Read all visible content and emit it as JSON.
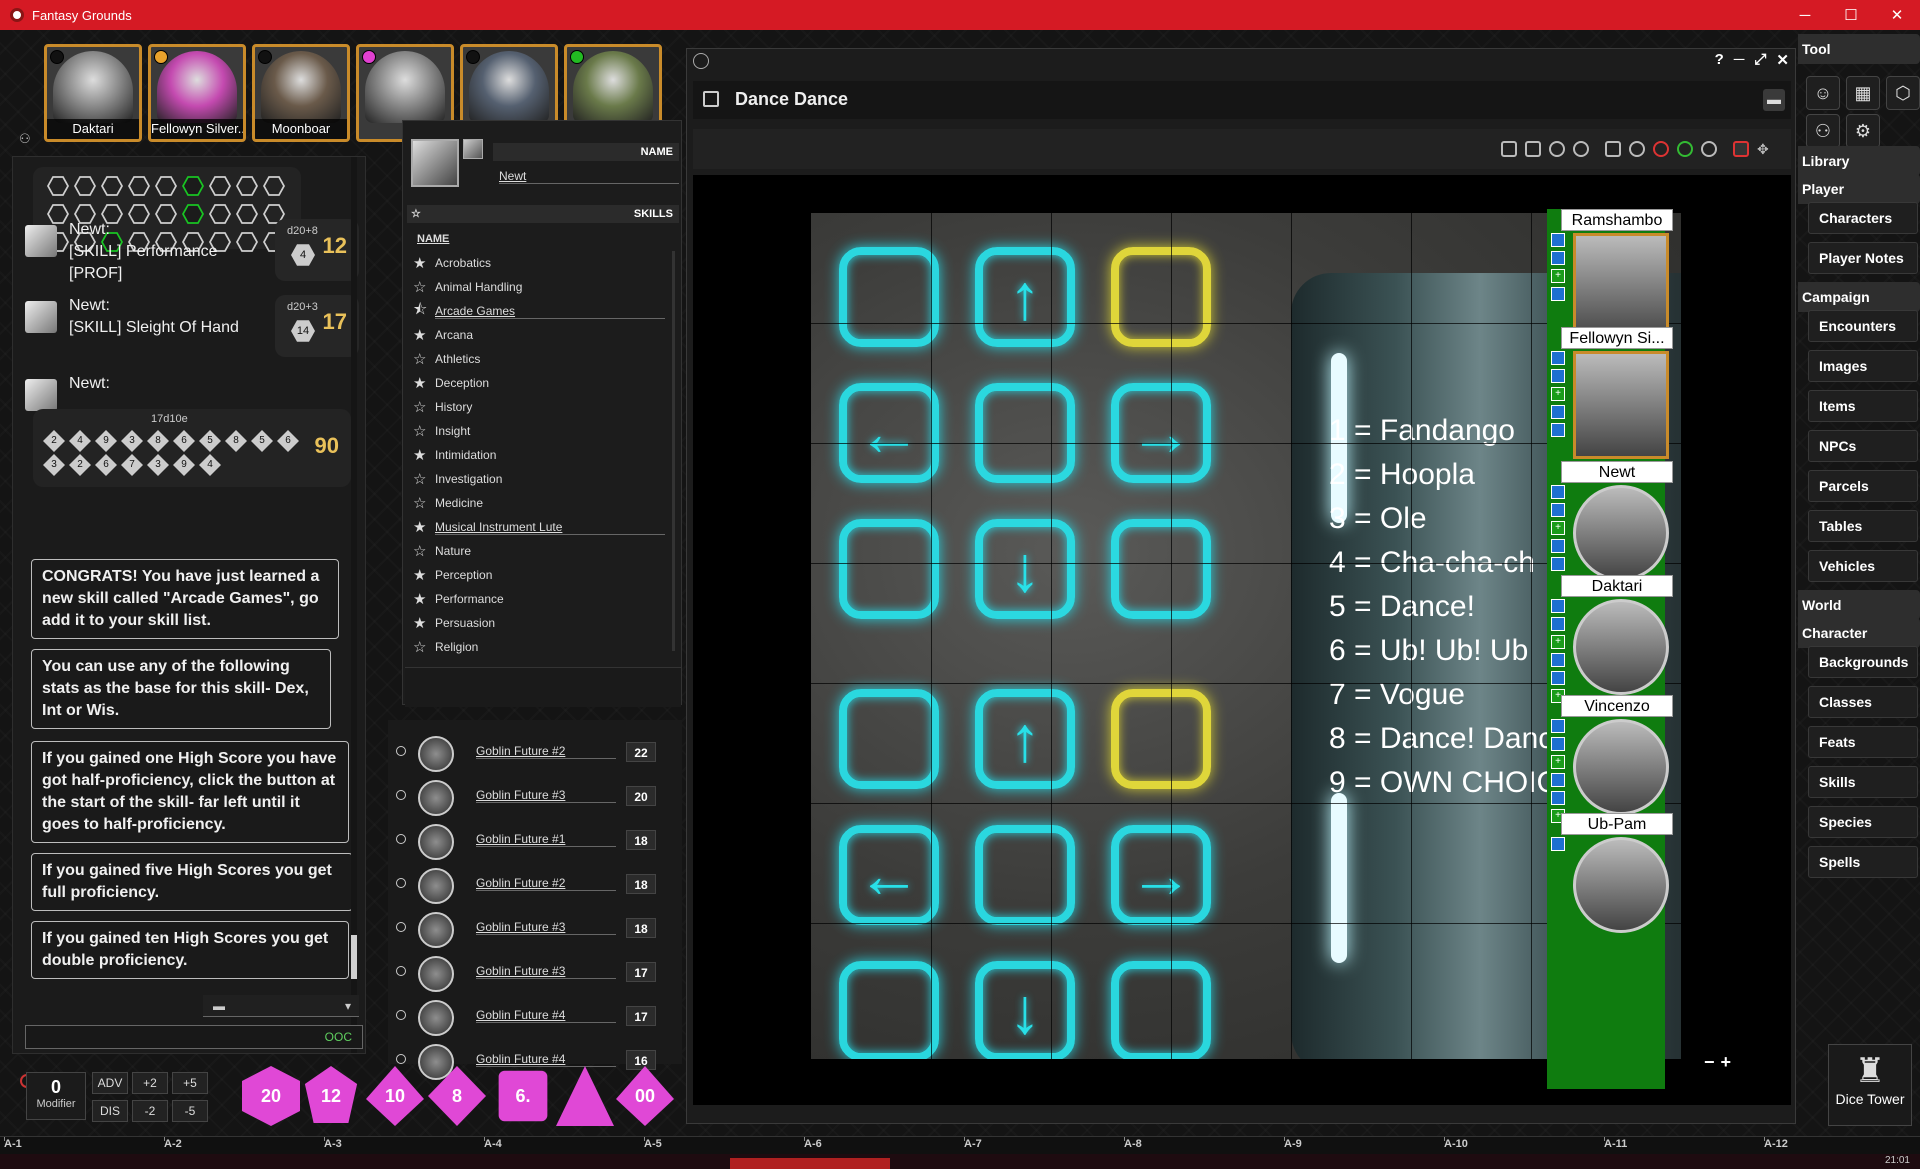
{
  "window": {
    "title": "Fantasy Grounds",
    "controls": [
      "─",
      "☐",
      "✕"
    ]
  },
  "portraits": [
    {
      "name": "Daktari",
      "dot": "#111111",
      "color": "#8a8a8a"
    },
    {
      "name": "Fellowyn Silver...",
      "dot": "#e8a22c",
      "color": "#c44ab0"
    },
    {
      "name": "Moonboar",
      "dot": "#111111",
      "color": "#6a5a4a"
    },
    {
      "name": "",
      "dot": "#e040d0",
      "color": "#888888"
    },
    {
      "name": "",
      "dot": "#111111",
      "color": "#556070"
    },
    {
      "name": "",
      "dot": "#22bb22",
      "color": "#6a7a4a"
    }
  ],
  "chat": {
    "messages": [
      {
        "author": "Newt:",
        "lines": [
          "[SKILL] Performance",
          "[PROF]"
        ],
        "dice": "d20+8",
        "die_face": "4",
        "total": "12"
      },
      {
        "author": "Newt:",
        "lines": [
          "[SKILL] Sleight Of Hand"
        ],
        "dice": "d20+3",
        "die_face": "14",
        "total": "17"
      },
      {
        "author": "Newt:",
        "lines": [],
        "dice": "17d10e",
        "total": "90"
      }
    ],
    "big_roll_faces": [
      "2",
      "4",
      "9",
      "3",
      "8",
      "6",
      "5",
      "8",
      "5",
      "6",
      "3",
      "2",
      "6",
      "7",
      "3",
      "9",
      "4"
    ],
    "info": [
      "CONGRATS! You have just learned a new skill called \"Arcade Games\", go add it to your skill list.",
      "You can use any of the following stats as the base for this skill- Dex, Int or Wis.",
      "If you gained one High Score you have got half-proficiency, click the button at the start of the skill- far left until it goes to half-proficiency.",
      "If you gained five High Scores you get full proficiency.",
      "If you gained ten High Scores you get double proficiency."
    ],
    "ooc_label": "OOC"
  },
  "skills_panel": {
    "name_header": "NAME",
    "name_value": "Newt",
    "skills_header": "SKILLS",
    "column_name": "NAME",
    "skills": [
      {
        "label": "Acrobatics",
        "prof": "full",
        "link": false
      },
      {
        "label": "Animal Handling",
        "prof": "none",
        "link": false
      },
      {
        "label": "Arcade Games",
        "prof": "half",
        "link": true
      },
      {
        "label": "Arcana",
        "prof": "full",
        "link": false
      },
      {
        "label": "Athletics",
        "prof": "none",
        "link": false
      },
      {
        "label": "Deception",
        "prof": "full",
        "link": false
      },
      {
        "label": "History",
        "prof": "none",
        "link": false
      },
      {
        "label": "Insight",
        "prof": "none",
        "link": false
      },
      {
        "label": "Intimidation",
        "prof": "full",
        "link": false
      },
      {
        "label": "Investigation",
        "prof": "none",
        "link": false
      },
      {
        "label": "Medicine",
        "prof": "none",
        "link": false
      },
      {
        "label": "Musical Instrument Lute",
        "prof": "full",
        "link": true
      },
      {
        "label": "Nature",
        "prof": "none",
        "link": false
      },
      {
        "label": "Perception",
        "prof": "full",
        "link": false
      },
      {
        "label": "Performance",
        "prof": "full",
        "link": false
      },
      {
        "label": "Persuasion",
        "prof": "full",
        "link": false
      },
      {
        "label": "Religion",
        "prof": "none",
        "link": false
      }
    ]
  },
  "combat_tracker": [
    {
      "name": "Goblin Future #2",
      "init": "22"
    },
    {
      "name": "Goblin Future #3",
      "init": "20"
    },
    {
      "name": "Goblin Future #1",
      "init": "18"
    },
    {
      "name": "Goblin Future #2",
      "init": "18"
    },
    {
      "name": "Goblin Future #3",
      "init": "18"
    },
    {
      "name": "Goblin Future #3",
      "init": "17"
    },
    {
      "name": "Goblin Future #4",
      "init": "17"
    },
    {
      "name": "Goblin Future #4",
      "init": "16"
    }
  ],
  "modifier": {
    "value": "0",
    "label": "Modifier",
    "buttons": [
      "ADV",
      "+2",
      "+5",
      "DIS",
      "-2",
      "-5"
    ]
  },
  "dice_tray": [
    "20",
    "12",
    "10",
    "8",
    "6.",
    "",
    "00"
  ],
  "image_window": {
    "title": "Dance Dance",
    "controls": [
      "?",
      "─",
      "⤢",
      "✕"
    ],
    "dance_moves": [
      "1 = Fandango",
      "2 = Hoopla",
      "3 = Ole",
      "4 = Cha-cha-ch",
      "5 = Dance!",
      "6 = Ub! Ub! Ub",
      "7 = Vogue",
      "8 = Dance! Dance!",
      "9 = OWN CHOIC"
    ],
    "zoom_minus": "−",
    "zoom_plus": "+"
  },
  "party_tokens": [
    {
      "name": "Ramshambo",
      "round": false,
      "effects": 4
    },
    {
      "name": "Fellowyn Si...",
      "round": false,
      "effects": 5
    },
    {
      "name": "Newt",
      "round": true,
      "effects": 5
    },
    {
      "name": "Daktari",
      "round": true,
      "effects": 6
    },
    {
      "name": "Vincenzo",
      "round": true,
      "effects": 6
    },
    {
      "name": "Ub-Pam",
      "round": true,
      "effects": 1
    }
  ],
  "sidebar": {
    "sections": [
      {
        "title": "Tool",
        "items": []
      },
      {
        "title": "Library",
        "items": []
      },
      {
        "title": "Player",
        "items": [
          "Characters",
          "Player Notes"
        ]
      },
      {
        "title": "Campaign",
        "items": [
          "Encounters",
          "Images",
          "Items",
          "NPCs",
          "Parcels",
          "Tables",
          "Vehicles"
        ]
      },
      {
        "title": "World",
        "items": []
      },
      {
        "title": "Character",
        "items": [
          "Backgrounds",
          "Classes",
          "Feats",
          "Skills",
          "Species",
          "Spells"
        ]
      }
    ],
    "dice_tower": "Dice Tower"
  },
  "ruler": [
    "A-1",
    "A-2",
    "A-3",
    "A-4",
    "A-5",
    "A-6",
    "A-7",
    "A-8",
    "A-9",
    "A-10",
    "A-11",
    "A-12"
  ],
  "taskbar": {
    "clock": "21:01"
  }
}
